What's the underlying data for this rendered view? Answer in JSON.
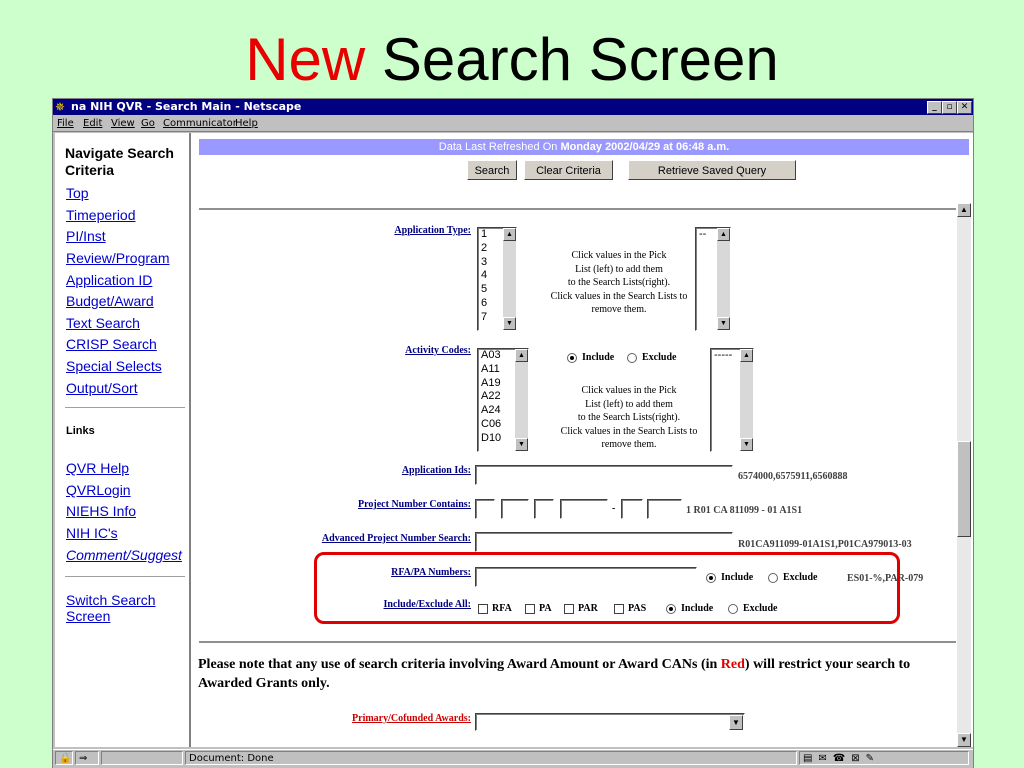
{
  "slide": {
    "title_accent": "New",
    "title_rest": "Search Screen"
  },
  "window": {
    "title": "na NIH QVR - Search Main - Netscape",
    "controls": {
      "minimize": "_",
      "maximize": "▫",
      "close": "✕"
    },
    "menu": [
      "File",
      "Edit",
      "View",
      "Go",
      "Communicator",
      "Help"
    ]
  },
  "nav": {
    "heading": "Navigate Search Criteria",
    "items": [
      "Top",
      "Timeperiod",
      "PI/Inst",
      "Review/Program",
      "Application ID",
      "Budget/Award",
      "Text Search",
      "CRISP Search",
      "Special Selects",
      "Output/Sort"
    ],
    "links_heading": "Links",
    "links": [
      "QVR Help ",
      "QVRLogin",
      "NIEHS Info",
      "NIH IC's",
      "Comment/Suggest"
    ],
    "switch_link": "Switch Search Screen"
  },
  "header": {
    "refresh_prefix": "Data Last Refreshed On ",
    "refresh_date": "Monday 2002/04/29 at 06:48 a.m.",
    "buttons": {
      "search": "Search",
      "clear": "Clear Criteria",
      "retrieve": "Retrieve Saved Query"
    }
  },
  "form": {
    "application_type": {
      "label": "Application Type:",
      "pick_options": [
        "1",
        "2",
        "3",
        "4",
        "5",
        "6",
        "7"
      ],
      "selected_options": [
        "--"
      ],
      "hint": [
        "Click values in the Pick",
        "List (left) to add them",
        "to the Search Lists(right).",
        "Click values in the Search Lists to",
        "remove them."
      ]
    },
    "activity_codes": {
      "label": "Activity Codes:",
      "pick_options": [
        "A03",
        "A11",
        "A19",
        "A22",
        "A24",
        "C06",
        "D10"
      ],
      "selected_options": [
        "-----"
      ],
      "include": "Include",
      "exclude": "Exclude",
      "hint": [
        "Click values in the Pick",
        "List (left) to add them",
        "to the Search Lists(right).",
        "Click values in the Search Lists to",
        "remove them."
      ]
    },
    "application_ids": {
      "label": "Application Ids:",
      "value": "",
      "example": "6574000,6575911,6560888"
    },
    "project_number": {
      "label": "Project Number Contains:",
      "dash": "-",
      "example": "1 R01 CA 811099 - 01 A1S1"
    },
    "advanced_project": {
      "label": "Advanced Project Number Search:",
      "value": "",
      "example": "R01CA911099-01A1S1,P01CA979013-03"
    },
    "rfa_pa": {
      "label": "RFA/PA Numbers:",
      "value": "",
      "include": "Include",
      "exclude": "Exclude",
      "example": "ES01-%,PAR-079"
    },
    "include_exclude_all": {
      "label": "Include/Exclude All:",
      "checks": [
        "RFA",
        "PA",
        "PAR",
        "PAS"
      ],
      "include": "Include",
      "exclude": "Exclude"
    },
    "notice": {
      "before": "Please note that any use of search criteria involving Award Amount or Award CANs (in ",
      "red_word": "Red",
      "after": ") will restrict your search to Awarded Grants only."
    },
    "primary_cofunded": {
      "label": "Primary/Cofunded Awards:",
      "value": ""
    }
  },
  "status": {
    "text": "Document: Done"
  },
  "colors": {
    "slide_bg": "#ccffcc",
    "accent_red": "#e60000",
    "title_bar": "#000080",
    "refresh_bar": "#9999ff",
    "link_blue": "#0000cc",
    "label_navy": "#000080",
    "highlight_red": "#e00000"
  }
}
